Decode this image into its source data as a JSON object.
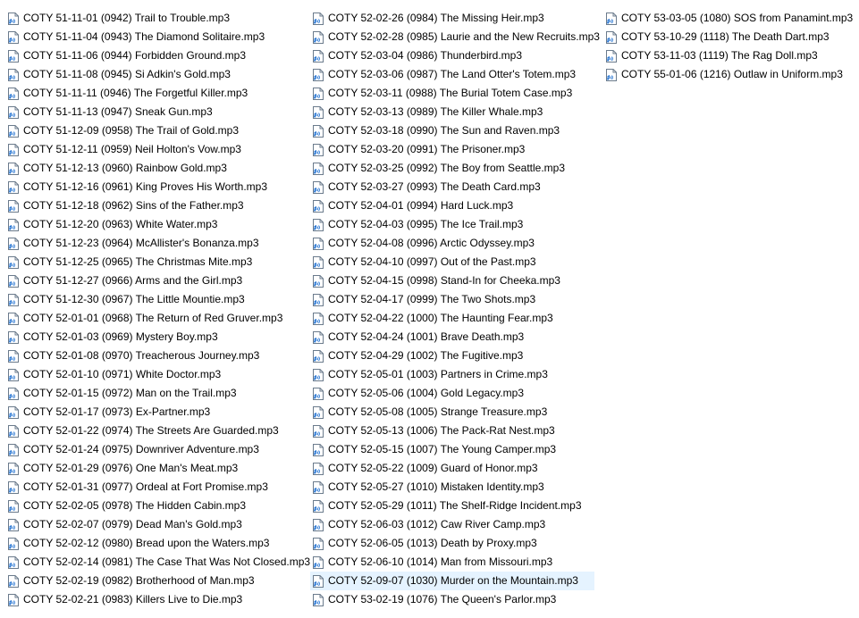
{
  "columns": [
    {
      "items": [
        {
          "name": "COTY 51-11-01 (0942) Trail to Trouble.mp3"
        },
        {
          "name": "COTY 51-11-04 (0943) The Diamond Solitaire.mp3"
        },
        {
          "name": "COTY 51-11-06 (0944) Forbidden Ground.mp3"
        },
        {
          "name": "COTY 51-11-08 (0945) Si Adkin's Gold.mp3"
        },
        {
          "name": "COTY 51-11-11 (0946) The Forgetful Killer.mp3"
        },
        {
          "name": "COTY 51-11-13 (0947) Sneak Gun.mp3"
        },
        {
          "name": "COTY 51-12-09 (0958) The Trail of Gold.mp3"
        },
        {
          "name": "COTY 51-12-11 (0959) Neil Holton's Vow.mp3"
        },
        {
          "name": "COTY 51-12-13 (0960) Rainbow Gold.mp3"
        },
        {
          "name": "COTY 51-12-16 (0961) King Proves His Worth.mp3"
        },
        {
          "name": "COTY 51-12-18 (0962) Sins of the Father.mp3"
        },
        {
          "name": "COTY 51-12-20 (0963) White Water.mp3"
        },
        {
          "name": "COTY 51-12-23 (0964) McAllister's Bonanza.mp3"
        },
        {
          "name": "COTY 51-12-25 (0965) The Christmas Mite.mp3"
        },
        {
          "name": "COTY 51-12-27 (0966) Arms and the Girl.mp3"
        },
        {
          "name": "COTY 51-12-30 (0967) The Little Mountie.mp3"
        },
        {
          "name": "COTY 52-01-01 (0968) The Return of Red Gruver.mp3"
        },
        {
          "name": "COTY 52-01-03 (0969) Mystery Boy.mp3"
        },
        {
          "name": "COTY 52-01-08 (0970) Treacherous Journey.mp3"
        },
        {
          "name": "COTY 52-01-10 (0971) White Doctor.mp3"
        },
        {
          "name": "COTY 52-01-15 (0972) Man on the Trail.mp3"
        },
        {
          "name": "COTY 52-01-17 (0973) Ex-Partner.mp3"
        },
        {
          "name": "COTY 52-01-22 (0974) The Streets Are Guarded.mp3"
        },
        {
          "name": "COTY 52-01-24 (0975) Downriver Adventure.mp3"
        },
        {
          "name": "COTY 52-01-29 (0976) One Man's Meat.mp3"
        },
        {
          "name": "COTY 52-01-31 (0977) Ordeal at Fort Promise.mp3"
        },
        {
          "name": "COTY 52-02-05 (0978) The Hidden Cabin.mp3"
        },
        {
          "name": "COTY 52-02-07 (0979) Dead Man's Gold.mp3"
        },
        {
          "name": "COTY 52-02-12 (0980) Bread upon the Waters.mp3"
        },
        {
          "name": "COTY 52-02-14 (0981) The Case That Was Not Closed.mp3"
        },
        {
          "name": "COTY 52-02-19 (0982) Brotherhood of Man.mp3"
        },
        {
          "name": "COTY 52-02-21 (0983) Killers Live to Die.mp3"
        }
      ]
    },
    {
      "items": [
        {
          "name": "COTY 52-02-26 (0984) The Missing Heir.mp3"
        },
        {
          "name": "COTY 52-02-28 (0985) Laurie and the New Recruits.mp3"
        },
        {
          "name": "COTY 52-03-04 (0986) Thunderbird.mp3"
        },
        {
          "name": "COTY 52-03-06 (0987) The Land Otter's Totem.mp3"
        },
        {
          "name": "COTY 52-03-11 (0988) The Burial Totem Case.mp3"
        },
        {
          "name": "COTY 52-03-13 (0989) The Killer Whale.mp3"
        },
        {
          "name": "COTY 52-03-18 (0990) The Sun and Raven.mp3"
        },
        {
          "name": "COTY 52-03-20 (0991) The Prisoner.mp3"
        },
        {
          "name": "COTY 52-03-25 (0992) The Boy from Seattle.mp3"
        },
        {
          "name": "COTY 52-03-27 (0993) The Death Card.mp3"
        },
        {
          "name": "COTY 52-04-01 (0994) Hard Luck.mp3"
        },
        {
          "name": "COTY 52-04-03 (0995) The Ice Trail.mp3"
        },
        {
          "name": "COTY 52-04-08 (0996) Arctic Odyssey.mp3"
        },
        {
          "name": "COTY 52-04-10 (0997) Out of the Past.mp3"
        },
        {
          "name": "COTY 52-04-15 (0998) Stand-In for Cheeka.mp3"
        },
        {
          "name": "COTY 52-04-17 (0999) The Two Shots.mp3"
        },
        {
          "name": "COTY 52-04-22 (1000) The Haunting Fear.mp3"
        },
        {
          "name": "COTY 52-04-24 (1001) Brave Death.mp3"
        },
        {
          "name": "COTY 52-04-29 (1002) The Fugitive.mp3"
        },
        {
          "name": "COTY 52-05-01 (1003) Partners in Crime.mp3"
        },
        {
          "name": "COTY 52-05-06 (1004) Gold Legacy.mp3"
        },
        {
          "name": "COTY 52-05-08 (1005) Strange Treasure.mp3"
        },
        {
          "name": "COTY 52-05-13 (1006) The Pack-Rat Nest.mp3"
        },
        {
          "name": "COTY 52-05-15 (1007) The Young Camper.mp3"
        },
        {
          "name": "COTY 52-05-22 (1009) Guard of Honor.mp3"
        },
        {
          "name": "COTY 52-05-27 (1010) Mistaken Identity.mp3"
        },
        {
          "name": "COTY 52-05-29 (1011) The Shelf-Ridge Incident.mp3"
        },
        {
          "name": "COTY 52-06-03 (1012) Caw River Camp.mp3"
        },
        {
          "name": "COTY 52-06-05 (1013) Death by Proxy.mp3"
        },
        {
          "name": "COTY 52-06-10 (1014) Man from Missouri.mp3"
        },
        {
          "name": "COTY 52-09-07 (1030) Murder on the Mountain.mp3",
          "selected": true
        },
        {
          "name": "COTY 53-02-19 (1076) The Queen's Parlor.mp3"
        }
      ]
    },
    {
      "items": [
        {
          "name": "COTY 53-03-05 (1080) SOS from Panamint.mp3"
        },
        {
          "name": "COTY 53-10-29 (1118) The Death Dart.mp3"
        },
        {
          "name": "COTY 53-11-03 (1119) The Rag Doll.mp3"
        },
        {
          "name": "COTY 55-01-06 (1216) Outlaw in Uniform.mp3"
        }
      ]
    }
  ],
  "icon": "audio-file-icon",
  "colors": {
    "selection_background": "#e5f3ff",
    "icon_body": "#ffffff",
    "icon_outline": "#6b7b8c",
    "icon_accent": "#1e6fd0"
  }
}
